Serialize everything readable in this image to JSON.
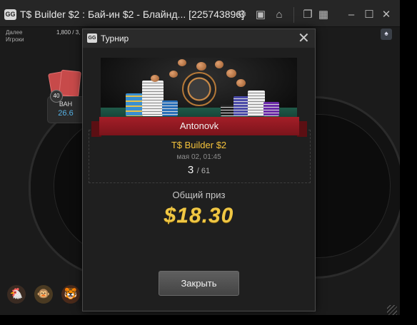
{
  "window": {
    "title": "T$ Builder $2 : Бай-ин $2 - Блайнд... [225743896]",
    "logo_text": "GG"
  },
  "table_info": {
    "left_line1": "Далее",
    "left_line2": "Игроки",
    "mid": "1,800 / 3,"
  },
  "player": {
    "name": "ВАН",
    "stack": "26.6",
    "level": "40"
  },
  "dialog": {
    "logo_text": "GG",
    "title": "Турнир",
    "close_glyph": "✕",
    "winner_name": "Antonovk",
    "tournament_name": "T$ Builder $2",
    "date": "мая 02, 01:45",
    "place": "3",
    "total": "/ 61",
    "prize_label": "Общий приз",
    "prize_amount": "$18.30",
    "close_button": "Закрыть"
  },
  "icons": {
    "settings": "gear-icon",
    "table_view": "table-icon",
    "home": "home-icon",
    "tile": "tile-icon",
    "grid": "grid-icon",
    "minimize": "minimize-icon",
    "maximize": "maximize-icon",
    "close": "close-icon"
  },
  "colors": {
    "accent_gold": "#f5c33b",
    "ribbon_red": "#a41e28",
    "stack_blue": "#55b2e6"
  }
}
